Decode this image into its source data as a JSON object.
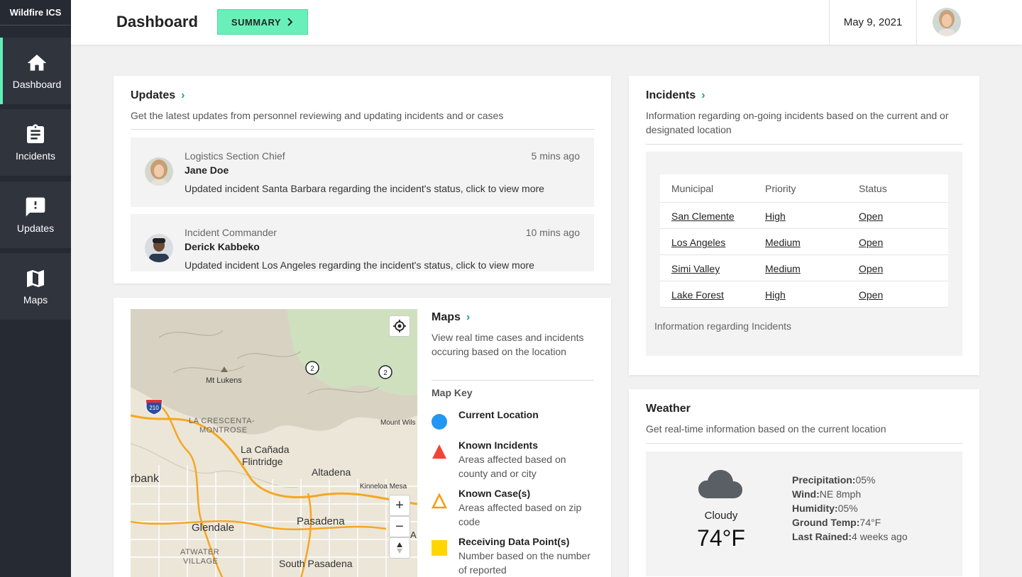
{
  "sidebar": {
    "brand": "Wildfire ICS",
    "items": [
      {
        "label": "Dashboard",
        "icon": "home-icon"
      },
      {
        "label": "Incidents",
        "icon": "clipboard-icon"
      },
      {
        "label": "Updates",
        "icon": "alert-icon"
      },
      {
        "label": "Maps",
        "icon": "map-icon"
      }
    ]
  },
  "header": {
    "title": "Dashboard",
    "summary_label": "SUMMARY",
    "date": "May 9, 2021"
  },
  "updates": {
    "title": "Updates",
    "subtitle": "Get the latest updates from personnel reviewing and updating incidents and or cases",
    "items": [
      {
        "role": "Logistics Section Chief",
        "name": "Jane Doe",
        "time": "5 mins ago",
        "message": "Updated incident Santa Barbara regarding the incident's status, click to view more"
      },
      {
        "role": "Incident Commander",
        "name": "Derick Kabbeko",
        "time": "10 mins ago",
        "message": "Updated incident Los Angeles regarding the incident's status, click to view more"
      }
    ]
  },
  "incidents": {
    "title": "Incidents",
    "subtitle": "Information regarding on-going incidents based on the current and or designated location",
    "columns": [
      "Municipal",
      "Priority",
      "Status"
    ],
    "rows": [
      {
        "municipal": "San Clemente",
        "priority": "High",
        "status": "Open"
      },
      {
        "municipal": "Los Angeles",
        "priority": "Medium",
        "status": "Open"
      },
      {
        "municipal": "Simi Valley",
        "priority": "Medium",
        "status": "Open"
      },
      {
        "municipal": "Lake Forest",
        "priority": "High",
        "status": "Open"
      }
    ],
    "note": "Information regarding Incidents"
  },
  "maps": {
    "title": "Maps",
    "subtitle": "View real time cases and incidents occuring based on the location",
    "key_title": "Map Key",
    "key": [
      {
        "title": "Current Location",
        "desc": ""
      },
      {
        "title": "Known Incidents",
        "desc": "Areas affected based on county and or city"
      },
      {
        "title": "Known Case(s)",
        "desc": "Areas affected based on zip code"
      },
      {
        "title": "Receiving Data Point(s)",
        "desc": "Number based on the number of reported"
      }
    ],
    "labels": {
      "mt_lukens": "Mt Lukens",
      "la_crescenta": "LA CRESCENTA-",
      "montrose": "MONTROSE",
      "la_canada": "La Cañada",
      "flintridge": "Flintridge",
      "altadena": "Altadena",
      "burbank": "rbank",
      "glendale": "Glendale",
      "pasadena": "Pasadena",
      "kinneloa": "Kinneloa Mesa",
      "mount_wilson": "Mount Wils",
      "atwater": "ATWATER",
      "village": "VILLAGE",
      "south_pasadena": "South Pasadena",
      "cluster_1": "2",
      "cluster_2": "2",
      "highway": "210",
      "partial_a": "A"
    },
    "colors": {
      "current_location": "#2196f3",
      "known_incidents": "#f44336",
      "known_cases": "#ff9800",
      "data_points": "#ffd600"
    }
  },
  "weather": {
    "title": "Weather",
    "subtitle": "Get real-time information based on the current location",
    "condition": "Cloudy",
    "temp": "74°F",
    "details": [
      {
        "label": "Precipitation:",
        "value": "05%"
      },
      {
        "label": "Wind:",
        "value": "NE 8mph"
      },
      {
        "label": "Humidity:",
        "value": "05%"
      },
      {
        "label": "Ground Temp:",
        "value": "74°F"
      },
      {
        "label": "Last Rained:",
        "value": "4 weeks ago"
      }
    ]
  },
  "colors": {
    "accent": "#69f0b9",
    "sidebar_bg": "#252a33",
    "link_chevron": "#1aa38a"
  }
}
